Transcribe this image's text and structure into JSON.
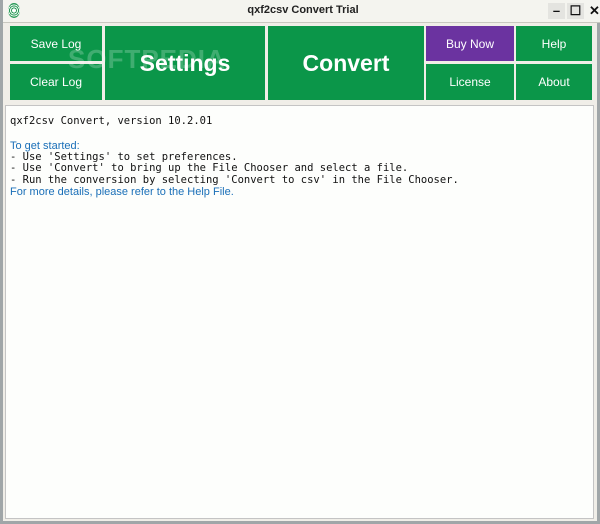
{
  "window": {
    "title": "qxf2csv Convert Trial",
    "app_icon": "app-logo-icon",
    "controls": {
      "minimize": "–",
      "maximize": "☐",
      "close": "✕"
    }
  },
  "toolbar": {
    "save_log": "Save Log",
    "clear_log": "Clear Log",
    "settings": "Settings",
    "convert": "Convert",
    "buy_now": "Buy Now",
    "help": "Help",
    "license": "License",
    "about": "About"
  },
  "watermark": "SOFTPEDIA",
  "colors": {
    "button_green": "#0b9649",
    "buy_purple": "#6b33a0",
    "info_blue": "#1a6fb8"
  },
  "log": {
    "version_line": "qxf2csv Convert, version 10.2.01",
    "get_started": "To get started:",
    "steps": [
      "- Use 'Settings' to set preferences.",
      "- Use 'Convert' to bring up the File Chooser and select a file.",
      "- Run the conversion by selecting 'Convert to csv' in the File Chooser."
    ],
    "more_details": "For more details, please refer to the Help File."
  }
}
